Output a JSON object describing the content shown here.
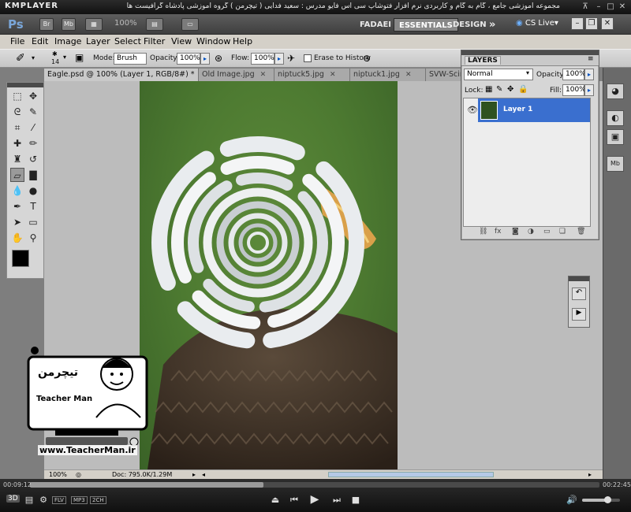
{
  "player": {
    "logo": "KMPLAYER",
    "caption": "مجموعه آموزشی جامع ، گام به گام و کاربردی نرم افزار فتوشاپ سی اس فایو  مدرس : سعید فدایی ( تیچرمن ) گروه آموزشی پادشاه گرافیست ها",
    "time_elapsed": "00:09:12",
    "time_total": "00:22:45",
    "progress": 0.41,
    "badges": [
      "FLV",
      "MP3",
      "2CH"
    ],
    "mode_label": "3D"
  },
  "appbar": {
    "logo": "Ps",
    "br": "Br",
    "mb": "Mb",
    "zoom": "100%",
    "workspaces": [
      "FADAEI",
      "ESSENTIALS",
      "DESIGN"
    ],
    "active_workspace": "ESSENTIALS",
    "more": "»",
    "cslive": "CS Live"
  },
  "menu": [
    "File",
    "Edit",
    "Image",
    "Layer",
    "Select",
    "Filter",
    "View",
    "Window",
    "Help"
  ],
  "options": {
    "brush_size": "14",
    "mode_label": "Mode:",
    "mode_value": "Brush",
    "opacity_label": "Opacity:",
    "opacity_value": "100%",
    "flow_label": "Flow:",
    "flow_value": "100%",
    "erase_history_label": "Erase to History"
  },
  "tabs": [
    {
      "label": "Eagle.psd @ 100% (Layer 1, RGB/8#) *",
      "active": true
    },
    {
      "label": "Old Image.jpg",
      "active": false
    },
    {
      "label": "niptuck5.jpg",
      "active": false
    },
    {
      "label": "niptuck1.jpg",
      "active": false
    },
    {
      "label": "SVW-Scin...",
      "active": false
    }
  ],
  "status": {
    "zoom": "100%",
    "doc": "Doc: 795.0K/1.29M"
  },
  "layers_panel": {
    "title": "LAYERS",
    "blend_mode": "Normal",
    "opacity_label": "Opacity:",
    "opacity_value": "100%",
    "lock_label": "Lock:",
    "fill_label": "Fill:",
    "fill_value": "100%",
    "layer_name": "Layer 1"
  },
  "watermark": {
    "brand_fa": "تیچرمن",
    "brand_en": "Teacher Man",
    "url": "www.TeacherMan.ir"
  },
  "colors": {
    "selection": "#3a6fcf",
    "workspace": "#7e7e7e",
    "background_green": "#4d7a31"
  }
}
